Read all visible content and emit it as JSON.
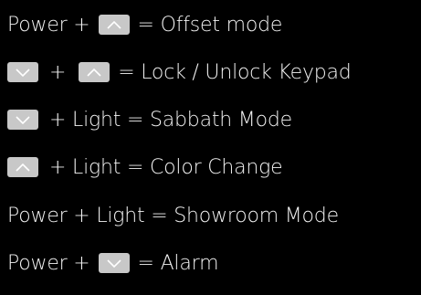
{
  "legend": {
    "rows": [
      {
        "pre": "Power +",
        "key": "up",
        "post": "= Offset mode"
      },
      {
        "key1": "down",
        "mid": "+",
        "key2": "up",
        "post": "= Lock / Unlock Keypad"
      },
      {
        "key": "down",
        "post": "+ Light = Sabbath Mode"
      },
      {
        "key": "up",
        "post": "+ Light = Color Change"
      },
      {
        "text": "Power + Light = Showroom Mode"
      },
      {
        "pre": "Power +",
        "key": "down",
        "post": "= Alarm"
      }
    ]
  },
  "icons": {
    "up": "chevron-up-key-icon",
    "down": "chevron-down-key-icon"
  },
  "colors": {
    "background": "#000000",
    "text": "#f2f2f2",
    "key_fill": "#c8c8c8",
    "key_glyph": "#ffffff"
  }
}
